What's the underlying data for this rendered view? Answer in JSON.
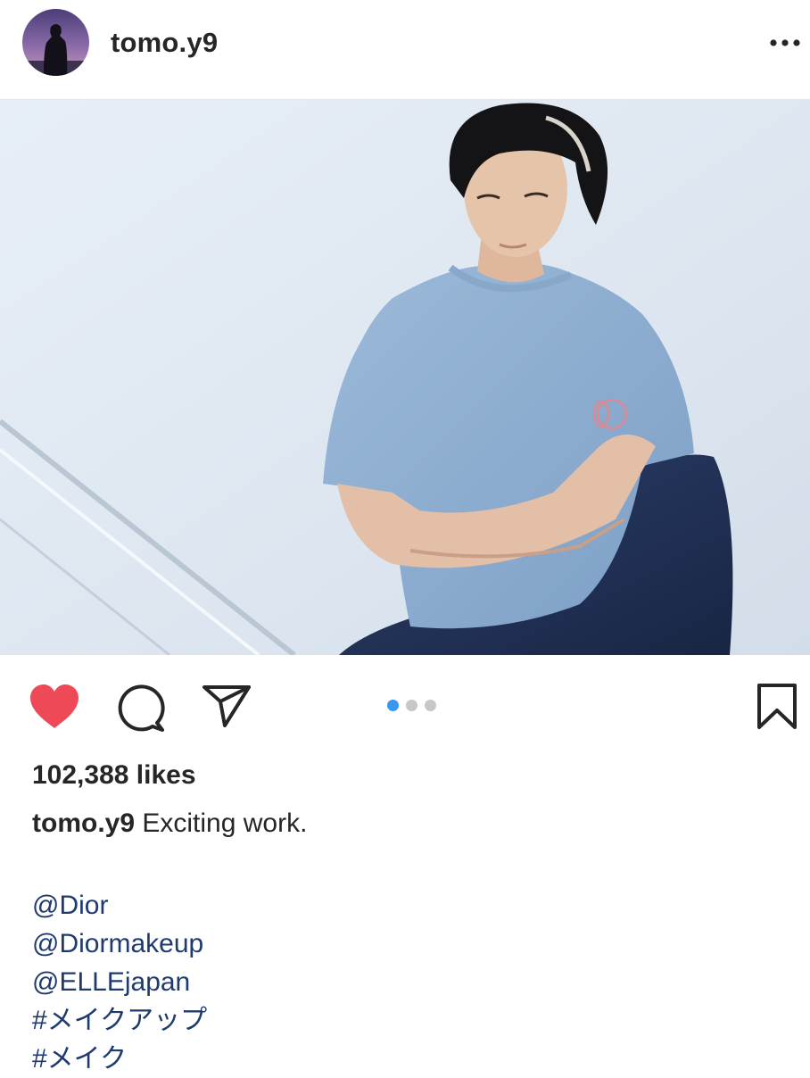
{
  "post": {
    "username": "tomo.y9",
    "more_icon": "more-horizontal-icon",
    "likes_text": "102,388 likes",
    "caption": {
      "username": "tomo.y9",
      "text": "Exciting work."
    },
    "tags": [
      "@Dior",
      "@Diormakeup",
      "@ELLEjapan",
      "#メイクアップ",
      "#メイク"
    ],
    "carousel": {
      "total": 3,
      "active": 1
    }
  },
  "actions": {
    "like_icon": "heart-filled-icon",
    "comment_icon": "comment-bubble-icon",
    "share_icon": "paper-plane-icon",
    "save_icon": "bookmark-icon"
  },
  "colors": {
    "like_red": "#ed4956",
    "active_dot": "#3897f0",
    "inactive_dot": "#c7c7c7",
    "mention_link": "#1e3a6e",
    "text": "#262626"
  }
}
